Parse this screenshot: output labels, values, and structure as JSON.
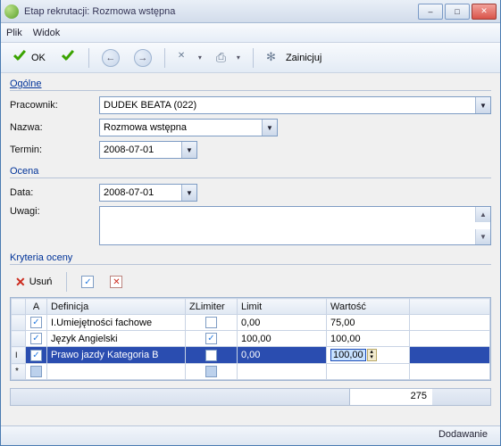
{
  "window": {
    "title": "Etap rekrutacji: Rozmowa wstępna"
  },
  "menu": {
    "file": "Plik",
    "view": "Widok"
  },
  "toolbar": {
    "ok": "OK",
    "init": "Zainicjuj"
  },
  "sections": {
    "general": "Ogólne",
    "rating": "Ocena",
    "criteria": "Kryteria oceny"
  },
  "fields": {
    "pracownik_label": "Pracownik:",
    "pracownik_value": "DUDEK BEATA (022)",
    "nazwa_label": "Nazwa:",
    "nazwa_value": "Rozmowa wstępna",
    "termin_label": "Termin:",
    "termin_value": "2008-07-01",
    "data_label": "Data:",
    "data_value": "2008-07-01",
    "uwagi_label": "Uwagi:",
    "uwagi_value": ""
  },
  "crit_toolbar": {
    "delete": "Usuń"
  },
  "grid": {
    "headers": {
      "a": "A",
      "def": "Definicja",
      "zlim": "ZLimiter",
      "limit": "Limit",
      "wart": "Wartość"
    },
    "rows": [
      {
        "a": true,
        "def": "I.Umiejętności fachowe",
        "zlim": false,
        "limit": "0,00",
        "wart": "75,00"
      },
      {
        "a": true,
        "def": "Język Angielski",
        "zlim": true,
        "limit": "100,00",
        "wart": "100,00"
      },
      {
        "a": true,
        "def": "Prawo jazdy Kategoria B",
        "zlim": false,
        "limit": "0,00",
        "wart": "100,00"
      }
    ],
    "total": "275"
  },
  "status": {
    "mode": "Dodawanie"
  }
}
